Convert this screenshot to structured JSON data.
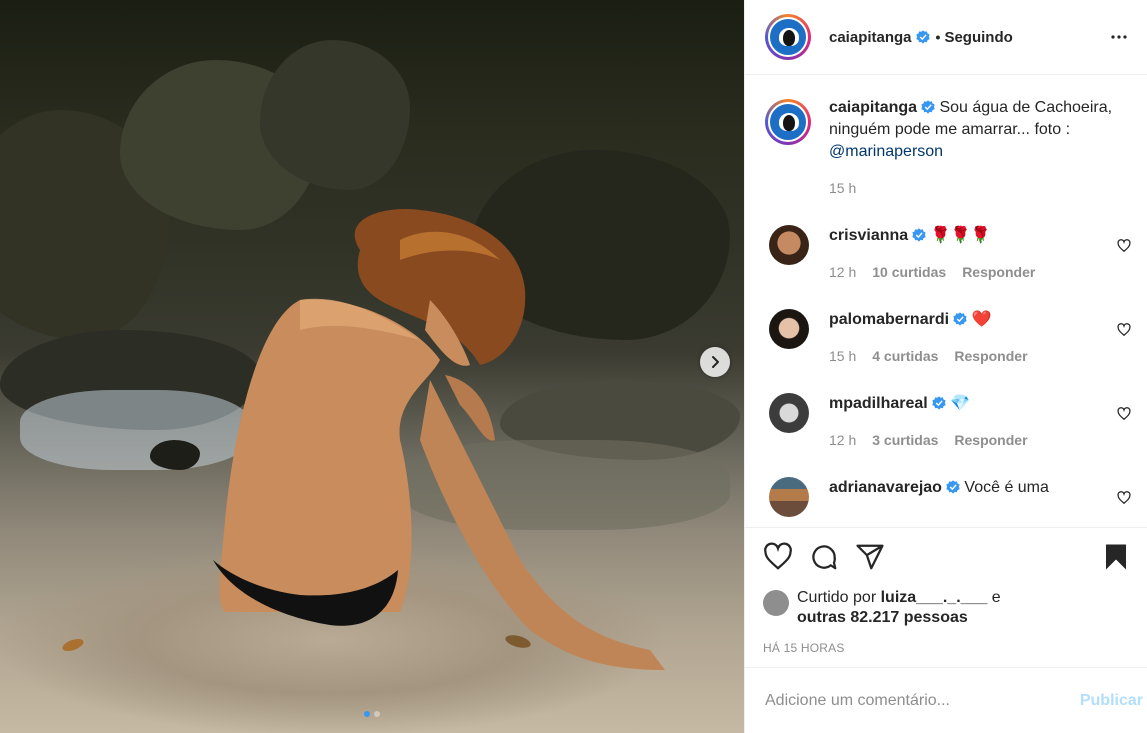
{
  "post": {
    "author": "caiapitanga",
    "follow_status": "Seguindo",
    "separator": "•"
  },
  "caption": {
    "username": "caiapitanga",
    "text": "Sou água de Cachoeira, ninguém pode me amarrar... foto : ",
    "mention": "@marinaperson",
    "time": "15 h"
  },
  "comments": [
    {
      "username": "crisvianna",
      "text": "🌹🌹🌹",
      "time": "12 h",
      "likes": "10 curtidas",
      "reply": "Responder"
    },
    {
      "username": "palomabernardi",
      "text": "❤️",
      "time": "15 h",
      "likes": "4 curtidas",
      "reply": "Responder"
    },
    {
      "username": "mpadilhareal",
      "text": "💎",
      "time": "12 h",
      "likes": "3 curtidas",
      "reply": "Responder"
    },
    {
      "username": "adrianavarejao",
      "text": "Você é uma"
    }
  ],
  "likes": {
    "prefix": "Curtido por ",
    "user": "luiza___._.___",
    "conj": " e",
    "others": "outras 82.217 pessoas"
  },
  "time_ago": "HÁ 15 HORAS",
  "add_comment": {
    "placeholder": "Adicione um comentário...",
    "post_label": "Publicar"
  },
  "colors": {
    "verified": "#3897f0",
    "link": "#00376b",
    "muted": "#8e8e8e",
    "post_disabled": "#b2dffc"
  },
  "icons": [
    "heart-icon",
    "comment-icon",
    "share-icon",
    "bookmark-icon",
    "more-icon",
    "chevron-right-icon",
    "verified-badge-icon"
  ]
}
